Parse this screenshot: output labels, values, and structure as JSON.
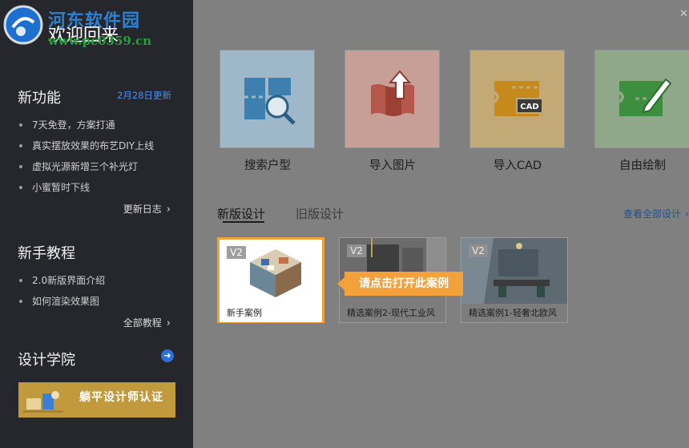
{
  "sidebar": {
    "welcome": "欢迎回来",
    "watermark_site": "河东软件园",
    "watermark_url": "www.pc0359.cn",
    "new_features": {
      "title": "新功能",
      "badge": "2月28日更新",
      "items": [
        "7天免登，方案打通",
        "真实摆放效果的布艺DIY上线",
        "虚拟光源新增三个补光灯",
        "小蜜暂时下线"
      ],
      "more": "更新日志"
    },
    "tutorials": {
      "title": "新手教程",
      "items": [
        "2.0新版界面介绍",
        "如何渲染效果图"
      ],
      "more": "全部教程"
    },
    "academy": {
      "title": "设计学院",
      "banner_title": "躺平设计师认证"
    }
  },
  "actions": [
    {
      "label": "搜索户型",
      "icon": "search-floorplan-icon",
      "bg": "#9eb8c9"
    },
    {
      "label": "导入图片",
      "icon": "import-image-icon",
      "bg": "#c79f97"
    },
    {
      "label": "导入CAD",
      "icon": "import-cad-icon",
      "bg": "#c3a975"
    },
    {
      "label": "自由绘制",
      "icon": "free-draw-icon",
      "bg": "#8fa889"
    }
  ],
  "tabs": {
    "new": "新版设计",
    "old": "旧版设计",
    "view_all": "查看全部设计"
  },
  "cases": [
    {
      "badge": "V2",
      "caption": "新手案例"
    },
    {
      "badge": "V2",
      "caption": "精选案例2-现代工业风"
    },
    {
      "badge": "V2",
      "caption": "精选案例1-轻奢北欧风"
    }
  ],
  "tooltip": "请点击打开此案例",
  "colors": {
    "sidebar_bg": "#25272c",
    "accent_blue": "#2e6fd8",
    "highlight_orange": "#f3a23b"
  }
}
